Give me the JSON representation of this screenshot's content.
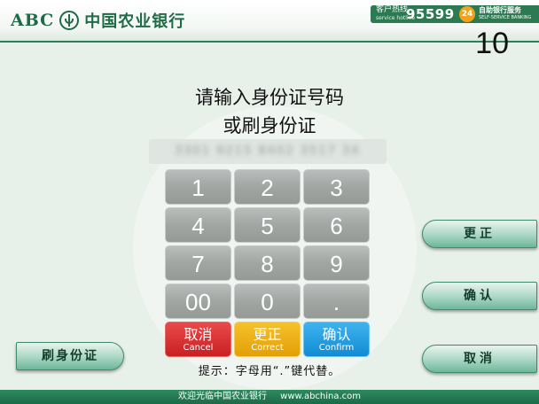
{
  "header": {
    "logo_abc": "ABC",
    "logo_name": "中国农业银行",
    "hotline_label": "客户热线",
    "hotline_label_en": "service hotline",
    "hotline_number": "95599",
    "badge": "24",
    "self_service": "自助银行服务",
    "self_service_en": "SELF-SERVICE BANKING"
  },
  "countdown": "10",
  "prompt": {
    "line1": "请输入身份证号码",
    "line2": "或刷身份证"
  },
  "id_field": {
    "value": "3301 9215 8402 3517 3X"
  },
  "keypad": {
    "digits": [
      "1",
      "2",
      "3",
      "4",
      "5",
      "6",
      "7",
      "8",
      "9",
      "00",
      "0",
      "."
    ],
    "cancel": {
      "cn": "取消",
      "en": "Cancel"
    },
    "correct": {
      "cn": "更正",
      "en": "Correct"
    },
    "confirm": {
      "cn": "确认",
      "en": "Confirm"
    }
  },
  "side_buttons": {
    "correct": "更正",
    "confirm": "确认",
    "cancel": "取消",
    "swipe_id": "刷身份证"
  },
  "hint": "提示：字母用“.”键代替。",
  "footer": {
    "welcome": "欢迎光临中国农业银行",
    "url": "www.abchina.com"
  },
  "colors": {
    "brand_green": "#1f6b47",
    "cancel_red": "#c91f22",
    "correct_yellow": "#e39f06",
    "confirm_blue": "#118bd3"
  }
}
